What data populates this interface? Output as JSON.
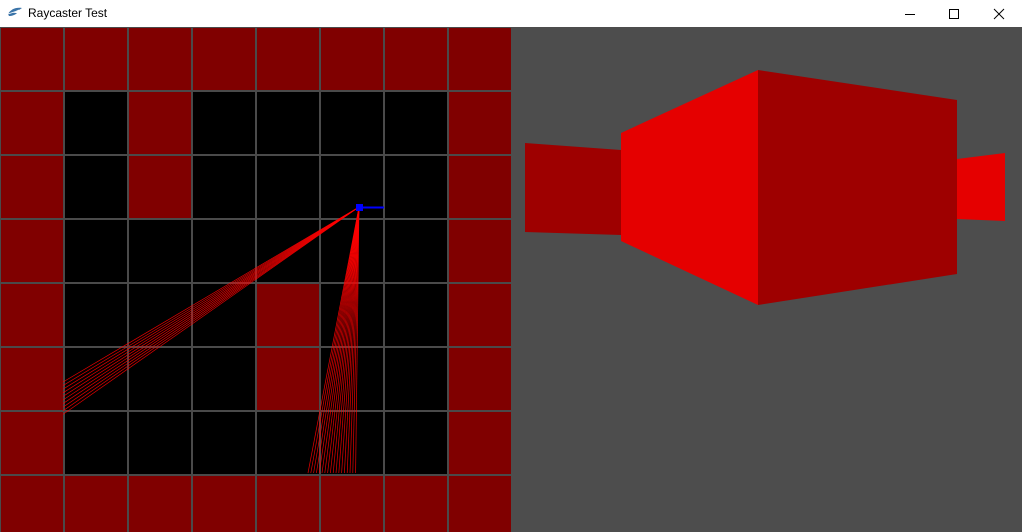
{
  "window": {
    "title": "Raycaster Test",
    "app_icon": "feather-python-icon"
  },
  "controls": {
    "minimize_icon": "minimize-icon",
    "maximize_icon": "maximize-icon",
    "close_icon": "close-icon"
  },
  "map": {
    "rows": 8,
    "cols": 8,
    "cells": [
      [
        1,
        1,
        1,
        1,
        1,
        1,
        1,
        1
      ],
      [
        1,
        0,
        1,
        0,
        0,
        0,
        0,
        1
      ],
      [
        1,
        0,
        1,
        0,
        0,
        0,
        0,
        1
      ],
      [
        1,
        0,
        0,
        0,
        0,
        0,
        0,
        1
      ],
      [
        1,
        0,
        0,
        0,
        1,
        0,
        0,
        1
      ],
      [
        1,
        0,
        0,
        0,
        1,
        0,
        0,
        1
      ],
      [
        1,
        0,
        0,
        0,
        0,
        0,
        0,
        1
      ],
      [
        1,
        1,
        1,
        1,
        1,
        1,
        1,
        1
      ]
    ],
    "wall_color": "#800000",
    "floor_color": "#000000",
    "grid_color": "#4a4a4a",
    "player_color": "#0000ff",
    "ray_color": "#ff0000"
  },
  "view3d": {
    "floor_ceiling_color": "#4d4d4d",
    "wall_bright_color": "#e50000",
    "wall_dark_color": "#9e0000"
  }
}
